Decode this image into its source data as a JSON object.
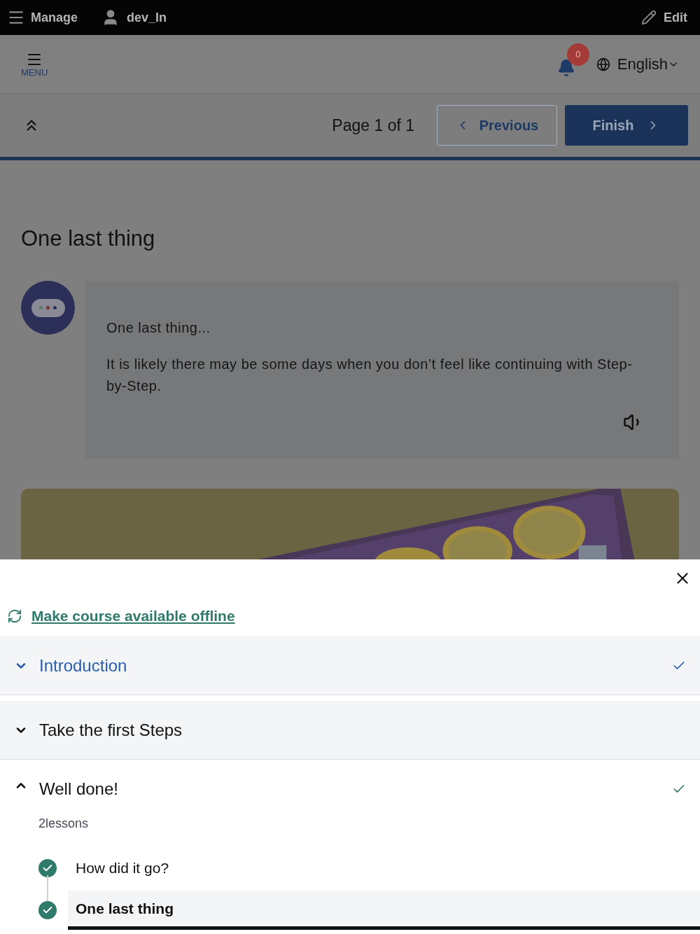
{
  "admin_bar": {
    "manage": "Manage",
    "user": "dev_In",
    "edit": "Edit"
  },
  "header": {
    "menu_label": "MENU",
    "notification_count": "0",
    "language": "English"
  },
  "pager": {
    "page_text": "Page 1 of 1",
    "previous": "Previous",
    "finish": "Finish"
  },
  "page": {
    "title": "One last thing",
    "message": {
      "lines": [
        "One last thing...",
        "It is likely there may be some days when you don’t feel like continuing with Step-by-Step."
      ]
    }
  },
  "sheet": {
    "offline_link": "Make course available offline",
    "sections": [
      {
        "title": "Introduction",
        "expanded": false,
        "selected": true,
        "completed": true
      },
      {
        "title": "Take the first Steps",
        "expanded": false,
        "selected": false,
        "completed": false
      },
      {
        "title": "Well done!",
        "expanded": true,
        "selected": false,
        "completed": true,
        "lesson_count": "2lessons",
        "lessons": [
          {
            "title": "How did it go?",
            "completed": true,
            "selected": false
          },
          {
            "title": "One last thing",
            "completed": true,
            "selected": true
          }
        ]
      }
    ]
  }
}
